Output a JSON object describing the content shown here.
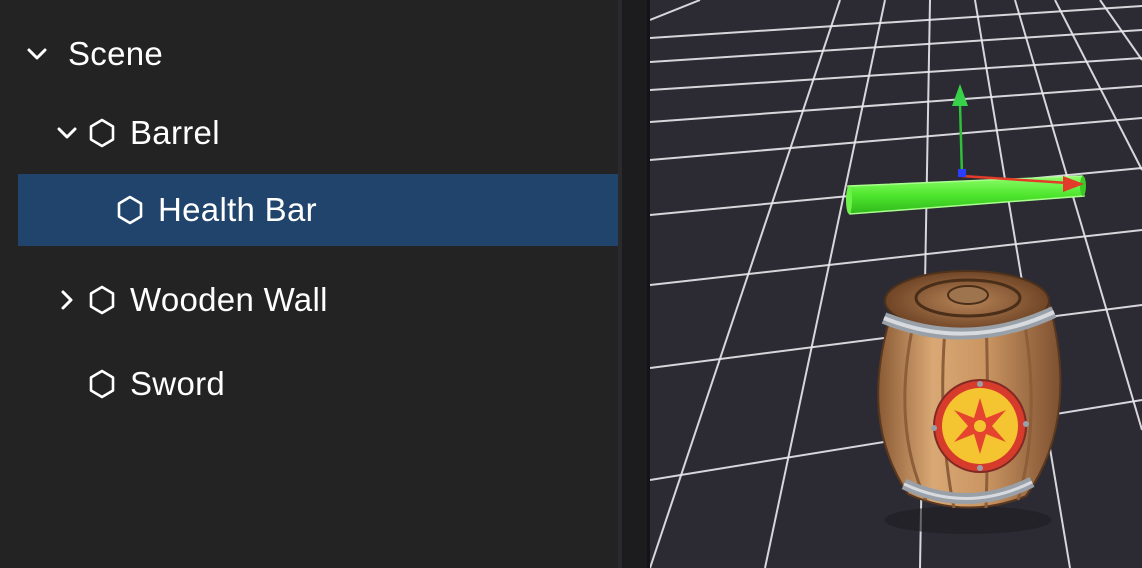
{
  "hierarchy": {
    "items": [
      {
        "label": "Scene",
        "depth": 0,
        "expander": "chevron-down",
        "icon": null,
        "selected": false
      },
      {
        "label": "Barrel",
        "depth": 1,
        "expander": "chevron-down",
        "icon": "hexagon",
        "selected": false
      },
      {
        "label": "Health Bar",
        "depth": 2,
        "expander": null,
        "icon": "hexagon",
        "selected": true
      },
      {
        "label": "Wooden Wall",
        "depth": 1,
        "expander": "chevron-right",
        "icon": "hexagon",
        "selected": false
      },
      {
        "label": "Sword",
        "depth": 1,
        "expander": null,
        "icon": "hexagon",
        "selected": false
      }
    ]
  },
  "viewport": {
    "grid_color": "#ffffff",
    "background_color": "#2c2b33",
    "objects": [
      "health-bar-mesh",
      "barrel-mesh"
    ],
    "gizmo": {
      "y_axis_color": "#3ad14a",
      "x_axis_color": "#e23b2a",
      "origin_color": "#2b3dff"
    },
    "health_bar_color": "#5bef3a"
  },
  "colors": {
    "panel_bg": "#232323",
    "selected_row": "#20446c",
    "text": "#ffffff"
  }
}
